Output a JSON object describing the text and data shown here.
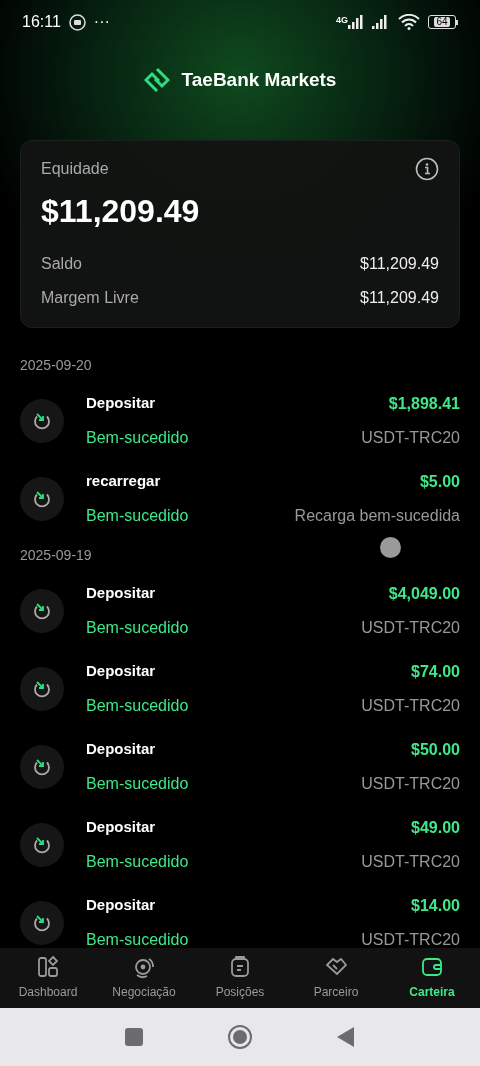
{
  "status_bar": {
    "time": "16:11",
    "dots": "···",
    "network": "4G",
    "battery": "64"
  },
  "header": {
    "brand": "TaeBank Markets"
  },
  "summary": {
    "title": "Equidade",
    "equity": "$11,209.49",
    "rows": [
      {
        "label": "Saldo",
        "value": "$11,209.49"
      },
      {
        "label": "Margem Livre",
        "value": "$11,209.49"
      }
    ]
  },
  "groups": [
    {
      "date": "2025-09-20",
      "items": [
        {
          "title": "Depositar",
          "status": "Bem-sucedido",
          "amount": "$1,898.41",
          "detail": "USDT-TRC20"
        },
        {
          "title": "recarregar",
          "status": "Bem-sucedido",
          "amount": "$5.00",
          "detail": "Recarga bem-sucedida"
        }
      ]
    },
    {
      "date": "2025-09-19",
      "items": [
        {
          "title": "Depositar",
          "status": "Bem-sucedido",
          "amount": "$4,049.00",
          "detail": "USDT-TRC20"
        },
        {
          "title": "Depositar",
          "status": "Bem-sucedido",
          "amount": "$74.00",
          "detail": "USDT-TRC20"
        },
        {
          "title": "Depositar",
          "status": "Bem-sucedido",
          "amount": "$50.00",
          "detail": "USDT-TRC20"
        },
        {
          "title": "Depositar",
          "status": "Bem-sucedido",
          "amount": "$49.00",
          "detail": "USDT-TRC20"
        },
        {
          "title": "Depositar",
          "status": "Bem-sucedido",
          "amount": "$14.00",
          "detail": "USDT-TRC20"
        }
      ]
    }
  ],
  "nav": [
    {
      "kind": "dashboard",
      "label": "Dashboard",
      "selected": false
    },
    {
      "kind": "trade",
      "label": "Negociação",
      "selected": false
    },
    {
      "kind": "positions",
      "label": "Posições",
      "selected": false
    },
    {
      "kind": "partner",
      "label": "Parceiro",
      "selected": false
    },
    {
      "kind": "wallet",
      "label": "Carteira",
      "selected": true
    }
  ]
}
